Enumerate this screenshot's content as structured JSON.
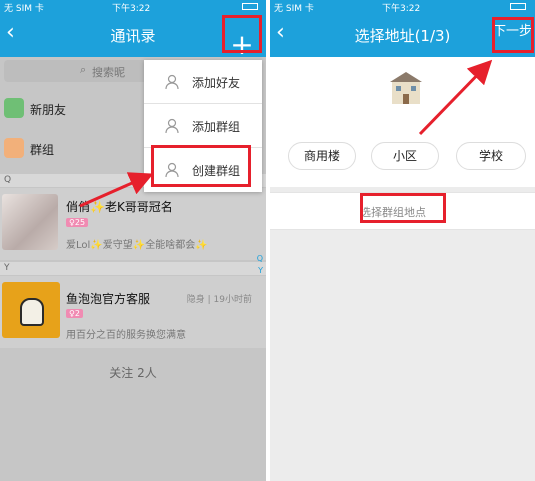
{
  "left": {
    "status": {
      "carrier": "无 SIM 卡",
      "wifi": "wifi-icon",
      "time": "下午3:22",
      "battery": "battery-icon"
    },
    "nav": {
      "title": "通讯录",
      "back": "back-icon",
      "add": "+"
    },
    "search": {
      "placeholder": "搜索昵"
    },
    "entries": [
      {
        "label": "新朋友",
        "icon": "new-friend-icon",
        "color": "#5cb85c"
      },
      {
        "label": "群组",
        "icon": "group-icon",
        "color": "#f0a060"
      }
    ],
    "sections": {
      "q": "Q",
      "y": "Y"
    },
    "contacts": [
      {
        "name": "俏俏✨老K哥哥冠名",
        "badge": "♀25",
        "sub": "爱Lol✨爱守望✨全能啥都会✨"
      },
      {
        "name": "鱼泡泡官方客服",
        "badge": "♀2",
        "status": "隐身 | 19小时前",
        "sub": "用百分之百的服务换您满意"
      }
    ],
    "index": {
      "q": "Q",
      "y": "Y"
    },
    "follow": "关注 2人",
    "menu": [
      {
        "label": "添加好友",
        "icon": "add-friend-icon"
      },
      {
        "label": "添加群组",
        "icon": "add-group-icon"
      },
      {
        "label": "创建群组",
        "icon": "create-group-icon"
      }
    ]
  },
  "right": {
    "status": {
      "carrier": "无 SIM 卡",
      "wifi": "wifi-icon",
      "time": "下午3:22",
      "battery": "battery-icon"
    },
    "nav": {
      "title": "选择地址(1/3)",
      "back": "back-icon",
      "next": "下一步"
    },
    "building": "building-icon",
    "options": [
      "商用楼",
      "小区",
      "学校"
    ],
    "input": {
      "placeholder": "选择群组地点"
    }
  },
  "colors": {
    "accent": "#1da1db",
    "highlight": "#e6202c"
  }
}
